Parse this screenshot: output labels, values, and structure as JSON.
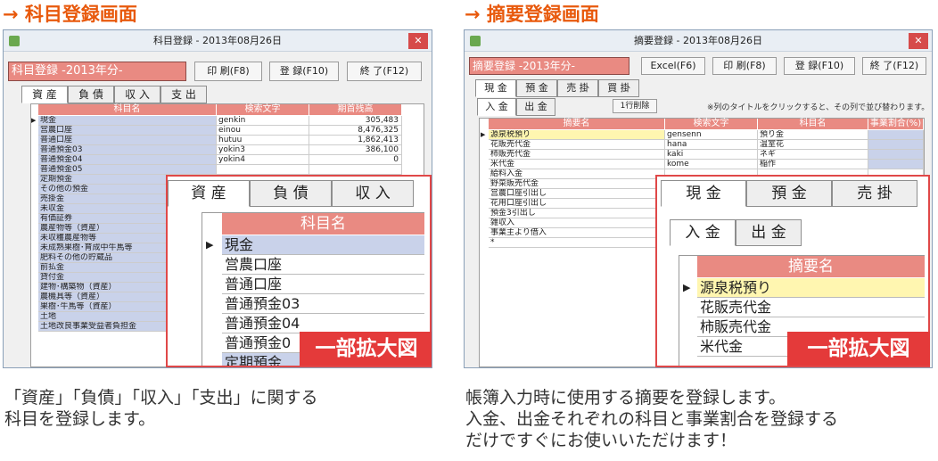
{
  "left": {
    "heading": "→ 科目登録画面",
    "window_title": "科目登録 - 2013年08月26日",
    "header_box": "科目登録 -2013年分-",
    "buttons": {
      "print": "印 刷(F8)",
      "register": "登 録(F10)",
      "exit": "終 了(F12)"
    },
    "tabs": [
      "資 産",
      "負 債",
      "収 入",
      "支 出"
    ],
    "columns": [
      "科目名",
      "検索文字",
      "期首残高"
    ],
    "rows": [
      {
        "name": "現金",
        "search": "genkin",
        "balance": "305,483"
      },
      {
        "name": "営農口座",
        "search": "einou",
        "balance": "8,476,325"
      },
      {
        "name": "普通口座",
        "search": "hutuu",
        "balance": "1,862,413"
      },
      {
        "name": "普通預金03",
        "search": "yokin3",
        "balance": "386,100"
      },
      {
        "name": "普通預金04",
        "search": "yokin4",
        "balance": "0"
      },
      {
        "name": "普通預金05",
        "search": "",
        "balance": ""
      },
      {
        "name": "定期預金",
        "search": "",
        "balance": ""
      },
      {
        "name": "その他の預金",
        "search": "",
        "balance": ""
      },
      {
        "name": "売掛金",
        "search": "",
        "balance": ""
      },
      {
        "name": "未収金",
        "search": "",
        "balance": ""
      },
      {
        "name": "有価証券",
        "search": "",
        "balance": ""
      },
      {
        "name": "農産物等（資産）",
        "search": "",
        "balance": ""
      },
      {
        "name": "未収穫農産物等",
        "search": "",
        "balance": ""
      },
      {
        "name": "未成熟果樹･育成中牛馬等",
        "search": "",
        "balance": ""
      },
      {
        "name": "肥料その他の貯蔵品",
        "search": "",
        "balance": ""
      },
      {
        "name": "前払金",
        "search": "",
        "balance": ""
      },
      {
        "name": "貸付金",
        "search": "",
        "balance": ""
      },
      {
        "name": "建物･構築物（資産）",
        "search": "",
        "balance": ""
      },
      {
        "name": "農機具等（資産）",
        "search": "",
        "balance": ""
      },
      {
        "name": "果樹･牛馬等（資産）",
        "search": "",
        "balance": ""
      },
      {
        "name": "土地",
        "search": "",
        "balance": ""
      },
      {
        "name": "土地改良事業受益者負担金",
        "search": "",
        "balance": ""
      }
    ],
    "zoom": {
      "tabs": [
        "資 産",
        "負 債",
        "収 入"
      ],
      "column": "科目名",
      "rows": [
        "現金",
        "営農口座",
        "普通口座",
        "普通預金03",
        "普通預金04",
        "普通預金0",
        "定期預金"
      ],
      "badge": "一部拡大図"
    },
    "description": [
      "「資産」「負債」「収入」「支出」に関する",
      "科目を登録します。"
    ]
  },
  "right": {
    "heading": "→ 摘要登録画面",
    "window_title": "摘要登録 - 2013年08月26日",
    "header_box": "摘要登録 -2013年分-",
    "buttons": {
      "excel": "Excel(F6)",
      "print": "印 刷(F8)",
      "register": "登 録(F10)",
      "exit": "終 了(F12)"
    },
    "tabs": [
      "現 金",
      "預 金",
      "売 掛",
      "買 掛"
    ],
    "subtabs": [
      "入 金",
      "出 金"
    ],
    "delete_row": "1行削除",
    "hint": "※列のタイトルをクリックすると、その列で並び替わります。",
    "columns": [
      "摘要名",
      "検索文字",
      "科目名",
      "事業割合(%)"
    ],
    "rows": [
      {
        "name": "源泉税預り",
        "search": "gensenn",
        "account": "預り金"
      },
      {
        "name": "花販売代金",
        "search": "hana",
        "account": "温室花"
      },
      {
        "name": "柿販売代金",
        "search": "kaki",
        "account": "ネギ"
      },
      {
        "name": "米代金",
        "search": "kome",
        "account": "稲作"
      },
      {
        "name": "給料入金",
        "search": "",
        "account": ""
      },
      {
        "name": "野菜販売代金",
        "search": "",
        "account": ""
      },
      {
        "name": "営農口座引出し",
        "search": "",
        "account": ""
      },
      {
        "name": "花用口座引出し",
        "search": "",
        "account": ""
      },
      {
        "name": "預金3引出し",
        "search": "",
        "account": ""
      },
      {
        "name": "雑収入",
        "search": "",
        "account": ""
      },
      {
        "name": "事業主より借入",
        "search": "",
        "account": ""
      },
      {
        "name": "*",
        "search": "",
        "account": ""
      }
    ],
    "zoom": {
      "tabs": [
        "現 金",
        "預 金",
        "売 掛"
      ],
      "subtabs": [
        "入 金",
        "出 金"
      ],
      "column": "摘要名",
      "rows": [
        "源泉税預り",
        "花販売代金",
        "柿販売代金",
        "米代金"
      ],
      "badge": "一部拡大図"
    },
    "description": [
      "帳簿入力時に使用する摘要を登録します。",
      "入金、出金それぞれの科目と事業割合を登録する",
      "だけですぐにお使いいただけます！"
    ]
  }
}
